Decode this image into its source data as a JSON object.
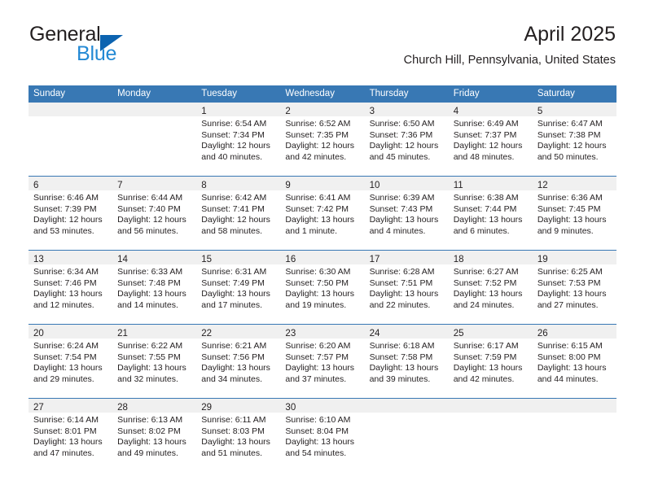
{
  "brand": {
    "name_part1": "General",
    "name_part2": "Blue",
    "triangle_color": "#0c63b0",
    "blue_color": "#2389d4"
  },
  "header": {
    "title": "April 2025",
    "subtitle": "Church Hill, Pennsylvania, United States"
  },
  "calendar": {
    "header_bg": "#3878b4",
    "daynum_band_bg": "#f0f0f0",
    "weekday_headers": [
      "Sunday",
      "Monday",
      "Tuesday",
      "Wednesday",
      "Thursday",
      "Friday",
      "Saturday"
    ],
    "weeks": [
      [
        {
          "day": "",
          "lines": []
        },
        {
          "day": "",
          "lines": []
        },
        {
          "day": "1",
          "lines": [
            "Sunrise: 6:54 AM",
            "Sunset: 7:34 PM",
            "Daylight: 12 hours",
            "and 40 minutes."
          ]
        },
        {
          "day": "2",
          "lines": [
            "Sunrise: 6:52 AM",
            "Sunset: 7:35 PM",
            "Daylight: 12 hours",
            "and 42 minutes."
          ]
        },
        {
          "day": "3",
          "lines": [
            "Sunrise: 6:50 AM",
            "Sunset: 7:36 PM",
            "Daylight: 12 hours",
            "and 45 minutes."
          ]
        },
        {
          "day": "4",
          "lines": [
            "Sunrise: 6:49 AM",
            "Sunset: 7:37 PM",
            "Daylight: 12 hours",
            "and 48 minutes."
          ]
        },
        {
          "day": "5",
          "lines": [
            "Sunrise: 6:47 AM",
            "Sunset: 7:38 PM",
            "Daylight: 12 hours",
            "and 50 minutes."
          ]
        }
      ],
      [
        {
          "day": "6",
          "lines": [
            "Sunrise: 6:46 AM",
            "Sunset: 7:39 PM",
            "Daylight: 12 hours",
            "and 53 minutes."
          ]
        },
        {
          "day": "7",
          "lines": [
            "Sunrise: 6:44 AM",
            "Sunset: 7:40 PM",
            "Daylight: 12 hours",
            "and 56 minutes."
          ]
        },
        {
          "day": "8",
          "lines": [
            "Sunrise: 6:42 AM",
            "Sunset: 7:41 PM",
            "Daylight: 12 hours",
            "and 58 minutes."
          ]
        },
        {
          "day": "9",
          "lines": [
            "Sunrise: 6:41 AM",
            "Sunset: 7:42 PM",
            "Daylight: 13 hours",
            "and 1 minute."
          ]
        },
        {
          "day": "10",
          "lines": [
            "Sunrise: 6:39 AM",
            "Sunset: 7:43 PM",
            "Daylight: 13 hours",
            "and 4 minutes."
          ]
        },
        {
          "day": "11",
          "lines": [
            "Sunrise: 6:38 AM",
            "Sunset: 7:44 PM",
            "Daylight: 13 hours",
            "and 6 minutes."
          ]
        },
        {
          "day": "12",
          "lines": [
            "Sunrise: 6:36 AM",
            "Sunset: 7:45 PM",
            "Daylight: 13 hours",
            "and 9 minutes."
          ]
        }
      ],
      [
        {
          "day": "13",
          "lines": [
            "Sunrise: 6:34 AM",
            "Sunset: 7:46 PM",
            "Daylight: 13 hours",
            "and 12 minutes."
          ]
        },
        {
          "day": "14",
          "lines": [
            "Sunrise: 6:33 AM",
            "Sunset: 7:48 PM",
            "Daylight: 13 hours",
            "and 14 minutes."
          ]
        },
        {
          "day": "15",
          "lines": [
            "Sunrise: 6:31 AM",
            "Sunset: 7:49 PM",
            "Daylight: 13 hours",
            "and 17 minutes."
          ]
        },
        {
          "day": "16",
          "lines": [
            "Sunrise: 6:30 AM",
            "Sunset: 7:50 PM",
            "Daylight: 13 hours",
            "and 19 minutes."
          ]
        },
        {
          "day": "17",
          "lines": [
            "Sunrise: 6:28 AM",
            "Sunset: 7:51 PM",
            "Daylight: 13 hours",
            "and 22 minutes."
          ]
        },
        {
          "day": "18",
          "lines": [
            "Sunrise: 6:27 AM",
            "Sunset: 7:52 PM",
            "Daylight: 13 hours",
            "and 24 minutes."
          ]
        },
        {
          "day": "19",
          "lines": [
            "Sunrise: 6:25 AM",
            "Sunset: 7:53 PM",
            "Daylight: 13 hours",
            "and 27 minutes."
          ]
        }
      ],
      [
        {
          "day": "20",
          "lines": [
            "Sunrise: 6:24 AM",
            "Sunset: 7:54 PM",
            "Daylight: 13 hours",
            "and 29 minutes."
          ]
        },
        {
          "day": "21",
          "lines": [
            "Sunrise: 6:22 AM",
            "Sunset: 7:55 PM",
            "Daylight: 13 hours",
            "and 32 minutes."
          ]
        },
        {
          "day": "22",
          "lines": [
            "Sunrise: 6:21 AM",
            "Sunset: 7:56 PM",
            "Daylight: 13 hours",
            "and 34 minutes."
          ]
        },
        {
          "day": "23",
          "lines": [
            "Sunrise: 6:20 AM",
            "Sunset: 7:57 PM",
            "Daylight: 13 hours",
            "and 37 minutes."
          ]
        },
        {
          "day": "24",
          "lines": [
            "Sunrise: 6:18 AM",
            "Sunset: 7:58 PM",
            "Daylight: 13 hours",
            "and 39 minutes."
          ]
        },
        {
          "day": "25",
          "lines": [
            "Sunrise: 6:17 AM",
            "Sunset: 7:59 PM",
            "Daylight: 13 hours",
            "and 42 minutes."
          ]
        },
        {
          "day": "26",
          "lines": [
            "Sunrise: 6:15 AM",
            "Sunset: 8:00 PM",
            "Daylight: 13 hours",
            "and 44 minutes."
          ]
        }
      ],
      [
        {
          "day": "27",
          "lines": [
            "Sunrise: 6:14 AM",
            "Sunset: 8:01 PM",
            "Daylight: 13 hours",
            "and 47 minutes."
          ]
        },
        {
          "day": "28",
          "lines": [
            "Sunrise: 6:13 AM",
            "Sunset: 8:02 PM",
            "Daylight: 13 hours",
            "and 49 minutes."
          ]
        },
        {
          "day": "29",
          "lines": [
            "Sunrise: 6:11 AM",
            "Sunset: 8:03 PM",
            "Daylight: 13 hours",
            "and 51 minutes."
          ]
        },
        {
          "day": "30",
          "lines": [
            "Sunrise: 6:10 AM",
            "Sunset: 8:04 PM",
            "Daylight: 13 hours",
            "and 54 minutes."
          ]
        },
        {
          "day": "",
          "lines": []
        },
        {
          "day": "",
          "lines": []
        },
        {
          "day": "",
          "lines": []
        }
      ]
    ]
  }
}
